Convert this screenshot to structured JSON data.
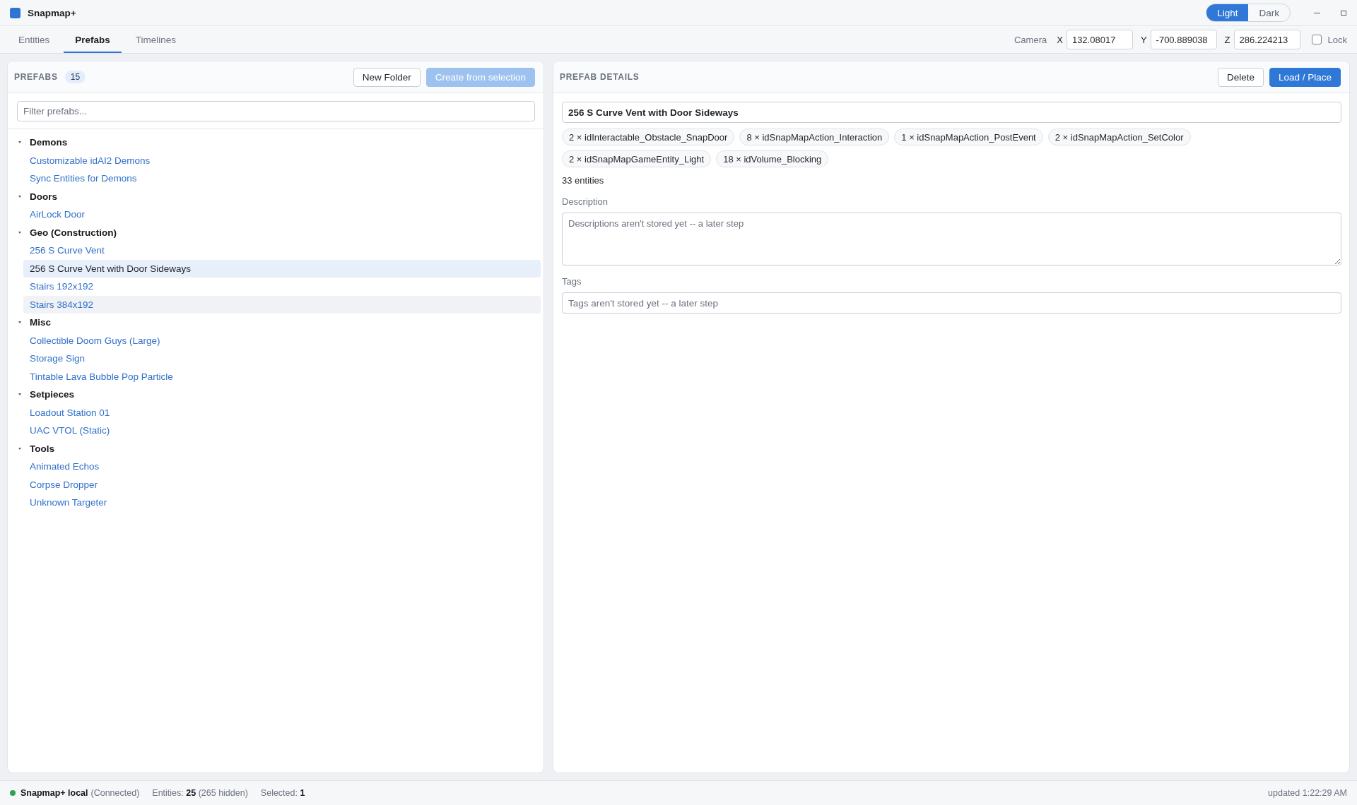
{
  "window": {
    "title": "Snapmap+",
    "theme_toggle": [
      {
        "label": "Light",
        "selected": true
      },
      {
        "label": "Dark",
        "selected": false
      }
    ]
  },
  "tabs": [
    {
      "label": "Entities",
      "selected": false
    },
    {
      "label": "Prefabs",
      "selected": true
    },
    {
      "label": "Timelines",
      "selected": false
    }
  ],
  "camera": {
    "label": "Camera",
    "fields": [
      {
        "axis": "X",
        "value": "132.08017"
      },
      {
        "axis": "Y",
        "value": "-700.889038"
      },
      {
        "axis": "Z",
        "value": "286.224213"
      }
    ],
    "lock": {
      "label": "Lock",
      "checked": false
    }
  },
  "prefabs_panel": {
    "title": "PREFABS",
    "count": "15",
    "buttons": [
      {
        "label": "New Folder",
        "kind": "secondary",
        "disabled": false
      },
      {
        "label": "Create from selection",
        "kind": "primary",
        "disabled": true
      }
    ],
    "filter": {
      "placeholder": "Filter prefabs..."
    },
    "tree": [
      {
        "label": "Demons",
        "expanded": true,
        "children": [
          {
            "label": "Customizable idAI2 Demons",
            "selected": false,
            "hovered": false
          },
          {
            "label": "Sync Entities for Demons",
            "selected": false,
            "hovered": false
          }
        ]
      },
      {
        "label": "Doors",
        "expanded": true,
        "children": [
          {
            "label": "AirLock Door",
            "selected": false,
            "hovered": false
          }
        ]
      },
      {
        "label": "Geo (Construction)",
        "expanded": true,
        "children": [
          {
            "label": "256 S Curve Vent",
            "selected": false,
            "hovered": false
          },
          {
            "label": "256 S Curve Vent with Door Sideways",
            "selected": true,
            "hovered": false
          },
          {
            "label": "Stairs 192x192",
            "selected": false,
            "hovered": false
          },
          {
            "label": "Stairs 384x192",
            "selected": false,
            "hovered": true
          }
        ]
      },
      {
        "label": "Misc",
        "expanded": true,
        "children": [
          {
            "label": "Collectible Doom Guys (Large)",
            "selected": false,
            "hovered": false
          },
          {
            "label": "Storage Sign",
            "selected": false,
            "hovered": false
          },
          {
            "label": "Tintable Lava Bubble Pop Particle",
            "selected": false,
            "hovered": false
          }
        ]
      },
      {
        "label": "Setpieces",
        "expanded": true,
        "children": [
          {
            "label": "Loadout Station 01",
            "selected": false,
            "hovered": false
          },
          {
            "label": "UAC VTOL (Static)",
            "selected": false,
            "hovered": false
          }
        ]
      },
      {
        "label": "Tools",
        "expanded": true,
        "children": [
          {
            "label": "Animated Echos",
            "selected": false,
            "hovered": false
          },
          {
            "label": "Corpse Dropper",
            "selected": false,
            "hovered": false
          },
          {
            "label": "Unknown Targeter",
            "selected": false,
            "hovered": false
          }
        ]
      }
    ]
  },
  "details_panel": {
    "title": "PREFAB DETAILS",
    "buttons": [
      {
        "label": "Delete",
        "kind": "secondary",
        "disabled": false
      },
      {
        "label": "Load / Place",
        "kind": "primary",
        "disabled": false
      }
    ],
    "name": {
      "value": "256 S Curve Vent with Door Sideways"
    },
    "entity_types": [
      "2 × idInteractable_Obstacle_SnapDoor",
      "8 × idSnapMapAction_Interaction",
      "1 × idSnapMapAction_PostEvent",
      "2 × idSnapMapAction_SetColor",
      "2 × idSnapMapGameEntity_Light",
      "18 × idVolume_Blocking"
    ],
    "entity_count": "33 entities",
    "description": {
      "label": "Description",
      "placeholder": "Descriptions aren't stored yet -- a later step"
    },
    "tags": {
      "label": "Tags",
      "placeholder": "Tags aren't stored yet -- a later step"
    }
  },
  "status_bar": {
    "connection": {
      "name": "Snapmap+ local",
      "state": "(Connected)",
      "connected": true
    },
    "entities": "Entities: **25** (265 hidden)",
    "selected": "Selected: **1**",
    "updated": "updated 1:22:29 AM"
  }
}
